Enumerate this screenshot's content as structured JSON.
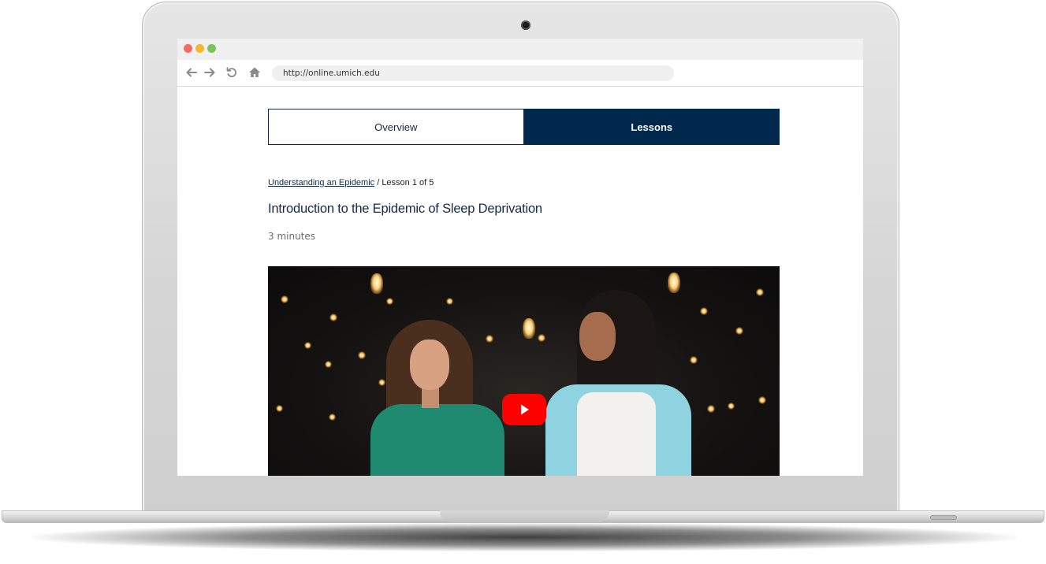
{
  "browser": {
    "url": "http://online.umich.edu",
    "window_dots": [
      "red",
      "yellow",
      "green"
    ],
    "nav_icons": [
      "back-arrow-icon",
      "forward-arrow-icon",
      "reload-icon",
      "home-icon"
    ]
  },
  "tabs": [
    {
      "label": "Overview",
      "active": false
    },
    {
      "label": "Lessons",
      "active": true
    }
  ],
  "breadcrumb": {
    "course_link": "Understanding an Epidemic",
    "separator": " / ",
    "lesson_position": "Lesson 1 of 5"
  },
  "lesson": {
    "title": "Introduction to the Epidemic of Sleep Deprivation",
    "duration": "3 minutes"
  },
  "video": {
    "play_icon": "play-icon",
    "play_color": "#ff0000"
  },
  "colors": {
    "brand_navy": "#00274c",
    "title_text": "#13294b"
  }
}
